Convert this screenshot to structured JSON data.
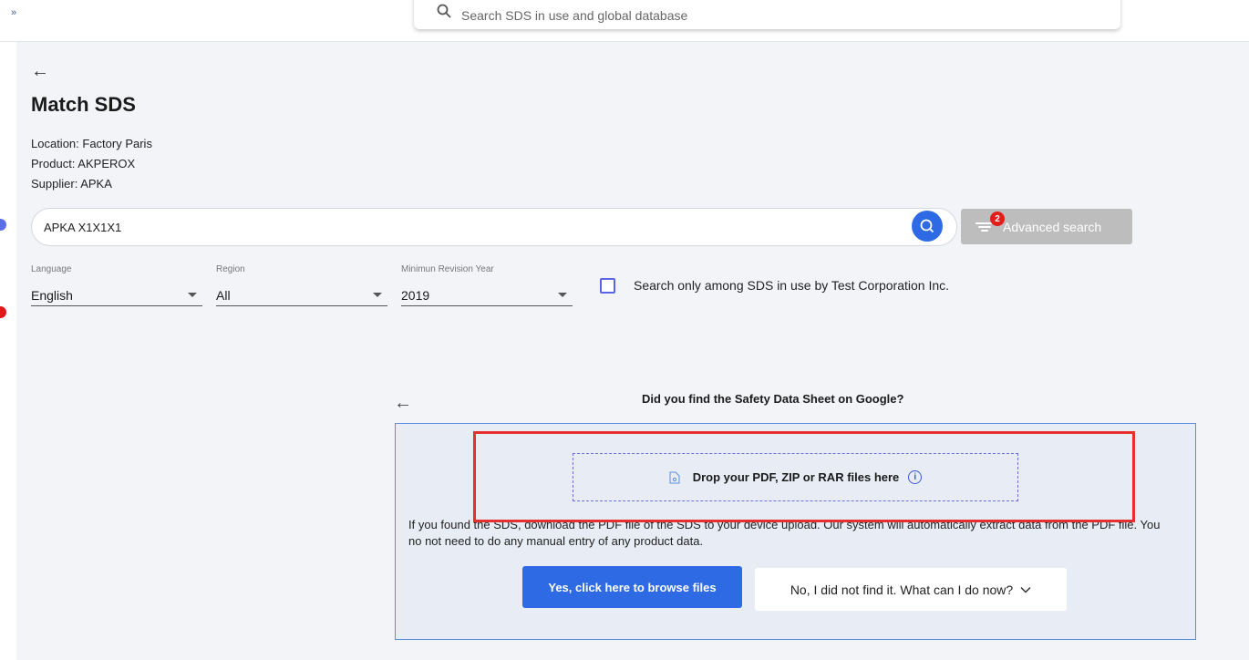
{
  "topbar": {
    "expand_icon": "»",
    "search_placeholder": "Search SDS in use and global database"
  },
  "page": {
    "title": "Match SDS",
    "location": "Location: Factory Paris",
    "product": "Product: AKPEROX",
    "supplier": "Supplier: APKA"
  },
  "search": {
    "value": "APKA X1X1X1",
    "advanced_label": "Advanced search",
    "advanced_badge": "2"
  },
  "filters": {
    "language": {
      "label": "Language",
      "value": "English"
    },
    "region": {
      "label": "Region",
      "value": "All"
    },
    "revision": {
      "label": "Minimun Revision Year",
      "value": "2019"
    },
    "only_in_use_label": "Search only among SDS in use by Test Corporation Inc."
  },
  "upload": {
    "question": "Did you find the Safety Data Sheet on Google?",
    "dropzone_label": "Drop your PDF, ZIP or RAR files here",
    "description": "If you found the SDS, download the PDF file of the SDS to your device upload. Our system will automatically extract data from the PDF file. You no not need to do any manual entry of any product data.",
    "yes_label": "Yes, click here to browse files",
    "no_label": "No, I did not find it. What can I do now?"
  },
  "colors": {
    "primary": "#2d6ae3",
    "highlight": "#e6302f",
    "badge": "#e51c1c"
  }
}
